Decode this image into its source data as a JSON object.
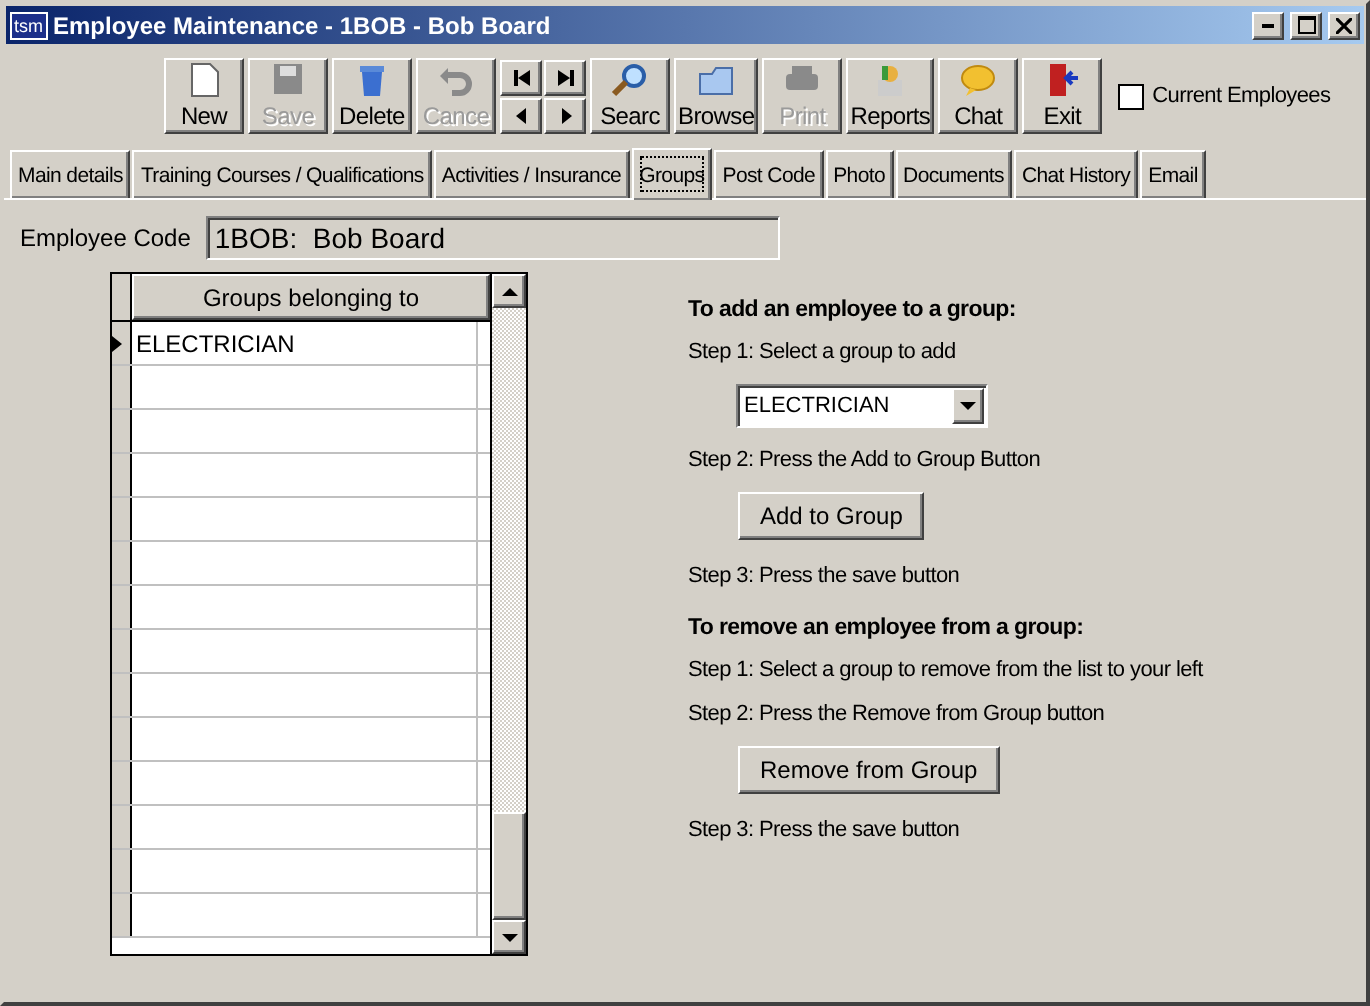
{
  "window": {
    "title": "Employee Maintenance - 1BOB - Bob Board",
    "app_icon": "tsm"
  },
  "toolbar": [
    {
      "kind": "new",
      "label": "New",
      "disabled": false
    },
    {
      "kind": "save",
      "label": "Save",
      "disabled": true
    },
    {
      "kind": "delete",
      "label": "Delete",
      "disabled": false
    },
    {
      "kind": "cancel",
      "label": "Cance",
      "disabled": true
    },
    {
      "kind": "nav"
    },
    {
      "kind": "search",
      "label": "Searc",
      "disabled": false
    },
    {
      "kind": "browse",
      "label": "Browse",
      "disabled": false
    },
    {
      "kind": "print",
      "label": "Print",
      "disabled": true
    },
    {
      "kind": "reports",
      "label": "Reports",
      "disabled": false
    },
    {
      "kind": "chat",
      "label": "Chat",
      "disabled": false
    },
    {
      "kind": "exit",
      "label": "Exit",
      "disabled": false
    }
  ],
  "current_employees": {
    "label": "Current Employees",
    "checked": false
  },
  "tabs": [
    {
      "label": "Main details",
      "selected": false
    },
    {
      "label": "Training Courses / Qualifications",
      "selected": false
    },
    {
      "label": "Activities / Insurance",
      "selected": false
    },
    {
      "label": "Groups",
      "selected": true
    },
    {
      "label": "Post Code",
      "selected": false
    },
    {
      "label": "Photo",
      "selected": false
    },
    {
      "label": "Documents",
      "selected": false
    },
    {
      "label": "Chat History",
      "selected": false
    },
    {
      "label": "Email",
      "selected": false
    }
  ],
  "employee_code": {
    "label": "Employee Code",
    "value": "1BOB:  Bob Board"
  },
  "groups_grid": {
    "column": "Groups belonging to",
    "rows": [
      {
        "value": "ELECTRICIAN",
        "selected": true
      }
    ]
  },
  "instructions": [
    {
      "kind": "heading",
      "text": "To add an employee to a group:"
    },
    {
      "kind": "step",
      "text": "Step 1: Select a group to add"
    },
    {
      "kind": "dropdown",
      "text": "ELECTRICIAN"
    },
    {
      "kind": "step",
      "text": "Step 2: Press the Add to Group Button"
    },
    {
      "kind": "button",
      "text": "Add to Group"
    },
    {
      "kind": "step",
      "text": "Step 3: Press the save button"
    },
    {
      "kind": "heading",
      "text": "To remove an employee from a group:"
    },
    {
      "kind": "step",
      "text": "Step 1: Select a group to remove from the list to your left"
    },
    {
      "kind": "step",
      "text": "Step 2: Press the Remove from Group button"
    },
    {
      "kind": "button",
      "text": "Remove from Group"
    },
    {
      "kind": "step",
      "text": "Step 3: Press the save button"
    }
  ]
}
